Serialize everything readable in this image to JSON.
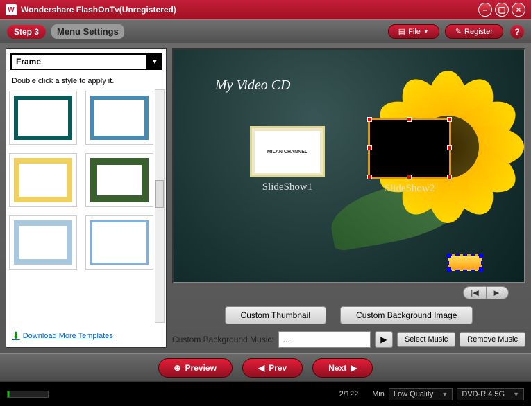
{
  "titlebar": {
    "app": "Wondershare FlashOnTv(Unregistered)"
  },
  "toolbar": {
    "step_badge": "Step 3",
    "step_title": "Menu Settings",
    "file_label": "File",
    "register_label": "Register"
  },
  "left": {
    "select_value": "Frame",
    "hint": "Double click a style to apply it.",
    "download_link": "Download More Templates"
  },
  "preview": {
    "title": "My Video CD",
    "slideshows": [
      {
        "label": "SlideShow1"
      },
      {
        "label": "SlideShow2"
      }
    ]
  },
  "controls": {
    "custom_thumb": "Custom Thumbnail",
    "custom_bg": "Custom Background Image",
    "music_label": "Custom Background Music:",
    "music_value": "...",
    "select_music": "Select Music",
    "remove_music": "Remove Music"
  },
  "footer": {
    "preview": "Preview",
    "prev": "Prev",
    "next": "Next"
  },
  "status": {
    "progress": "2/122",
    "unit": "Min",
    "quality": "Low Quality",
    "media": "DVD-R 4.5G"
  }
}
